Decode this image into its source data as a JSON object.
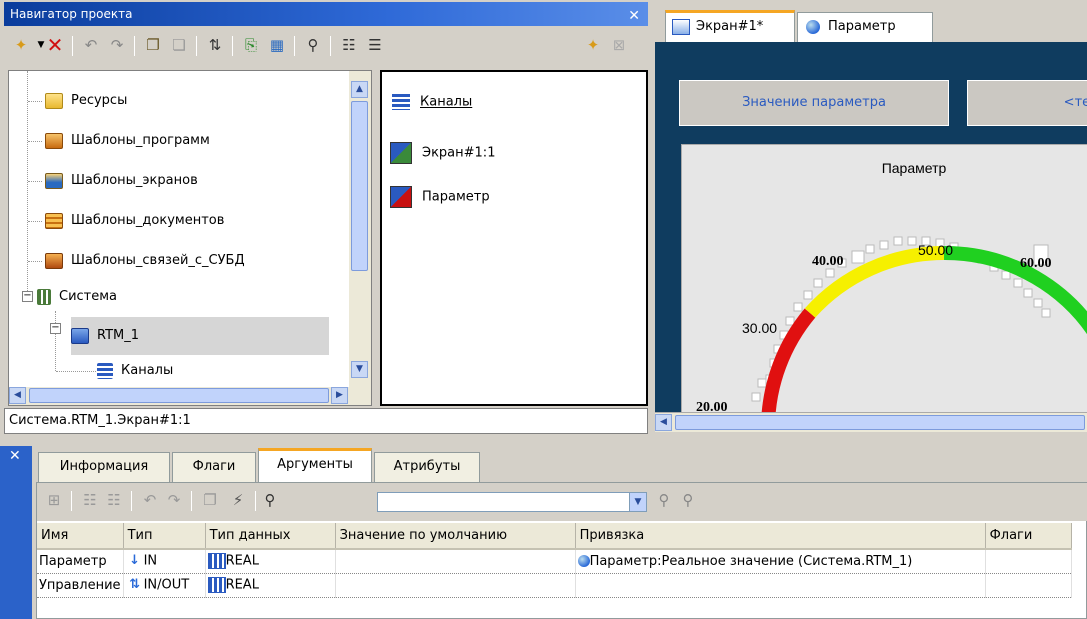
{
  "navigator": {
    "title": "Навигатор проекта",
    "tree_items": [
      {
        "label": "Ресурсы",
        "icon": "folder-icon"
      },
      {
        "label": "Шаблоны_программ",
        "icon": "program-template-icon"
      },
      {
        "label": "Шаблоны_экранов",
        "icon": "screen-template-icon"
      },
      {
        "label": "Шаблоны_документов",
        "icon": "document-template-icon"
      },
      {
        "label": "Шаблоны_связей_с_СУБД",
        "icon": "db-template-icon"
      },
      {
        "label": "Система",
        "icon": "system-icon"
      },
      {
        "label": "RTM_1",
        "icon": "rtm-icon"
      },
      {
        "label": "Каналы",
        "icon": "channels-icon"
      }
    ],
    "items": [
      {
        "label": "Каналы",
        "icon": "channels-icon"
      },
      {
        "label": "Экран#1:1",
        "icon": "screen-link-icon"
      },
      {
        "label": "Параметр",
        "icon": "parameter-link-icon"
      }
    ],
    "status_path": "Система.RTM_1.Экран#1:1"
  },
  "editor": {
    "tabs": [
      {
        "label": "Экран#1*",
        "icon": "screen-icon",
        "active": true
      },
      {
        "label": "Параметр",
        "icon": "parameter-icon",
        "active": false
      }
    ],
    "value_button": "Значение параметра",
    "value_button2": "<тек",
    "gauge": {
      "title": "Параметр",
      "scale_labels": [
        "20.00",
        "30.00",
        "40.00",
        "50.00",
        "60.00"
      ],
      "zones": {
        "red": "#e01010",
        "yellow": "#f6f000",
        "green": "#20d020"
      }
    }
  },
  "props": {
    "tabs": [
      {
        "label": "Информация",
        "active": false
      },
      {
        "label": "Флаги",
        "active": false
      },
      {
        "label": "Аргументы",
        "active": true
      },
      {
        "label": "Атрибуты",
        "active": false
      }
    ],
    "search": {
      "value": ""
    },
    "columns": [
      "Имя",
      "Тип",
      "Тип данных",
      "Значение по умолчанию",
      "Привязка",
      "Флаги"
    ],
    "rows": [
      {
        "name": "Параметр",
        "type": "IN",
        "datatype": "REAL",
        "default": "",
        "binding": "Параметр:Реальное значение (Система.RTM_1)",
        "flags": ""
      },
      {
        "name": "Управление",
        "type": "IN/OUT",
        "datatype": "REAL",
        "default": "",
        "binding": "",
        "flags": ""
      }
    ]
  },
  "colors": {
    "title_bar": "#2f6ad8",
    "screen_background": "#0f3c5f",
    "tab_accent": "#f5a623"
  }
}
